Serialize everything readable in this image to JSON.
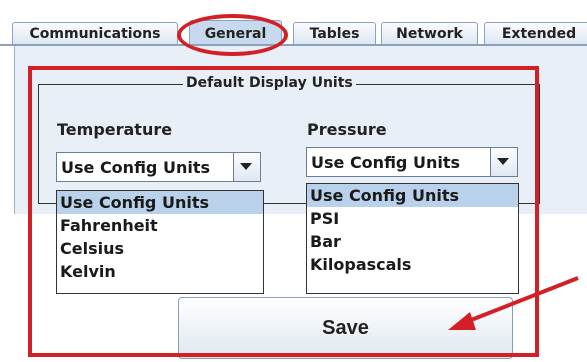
{
  "tabs": [
    {
      "label": "Communications",
      "active": false
    },
    {
      "label": "General",
      "active": true
    },
    {
      "label": "Tables",
      "active": false
    },
    {
      "label": "Network",
      "active": false
    },
    {
      "label": "Extended",
      "active": false
    }
  ],
  "group": {
    "title": "Default Display Units"
  },
  "temperature": {
    "label": "Temperature",
    "selected": "Use Config Units",
    "options": [
      "Use Config Units",
      "Fahrenheit",
      "Celsius",
      "Kelvin"
    ]
  },
  "pressure": {
    "label": "Pressure",
    "selected": "Use Config Units",
    "options": [
      "Use Config Units",
      "PSI",
      "Bar",
      "Kilopascals"
    ]
  },
  "save_label": "Save",
  "colors": {
    "annotation": "#d32027",
    "selection": "#b9d1ea",
    "panel": "#e9eff6"
  }
}
